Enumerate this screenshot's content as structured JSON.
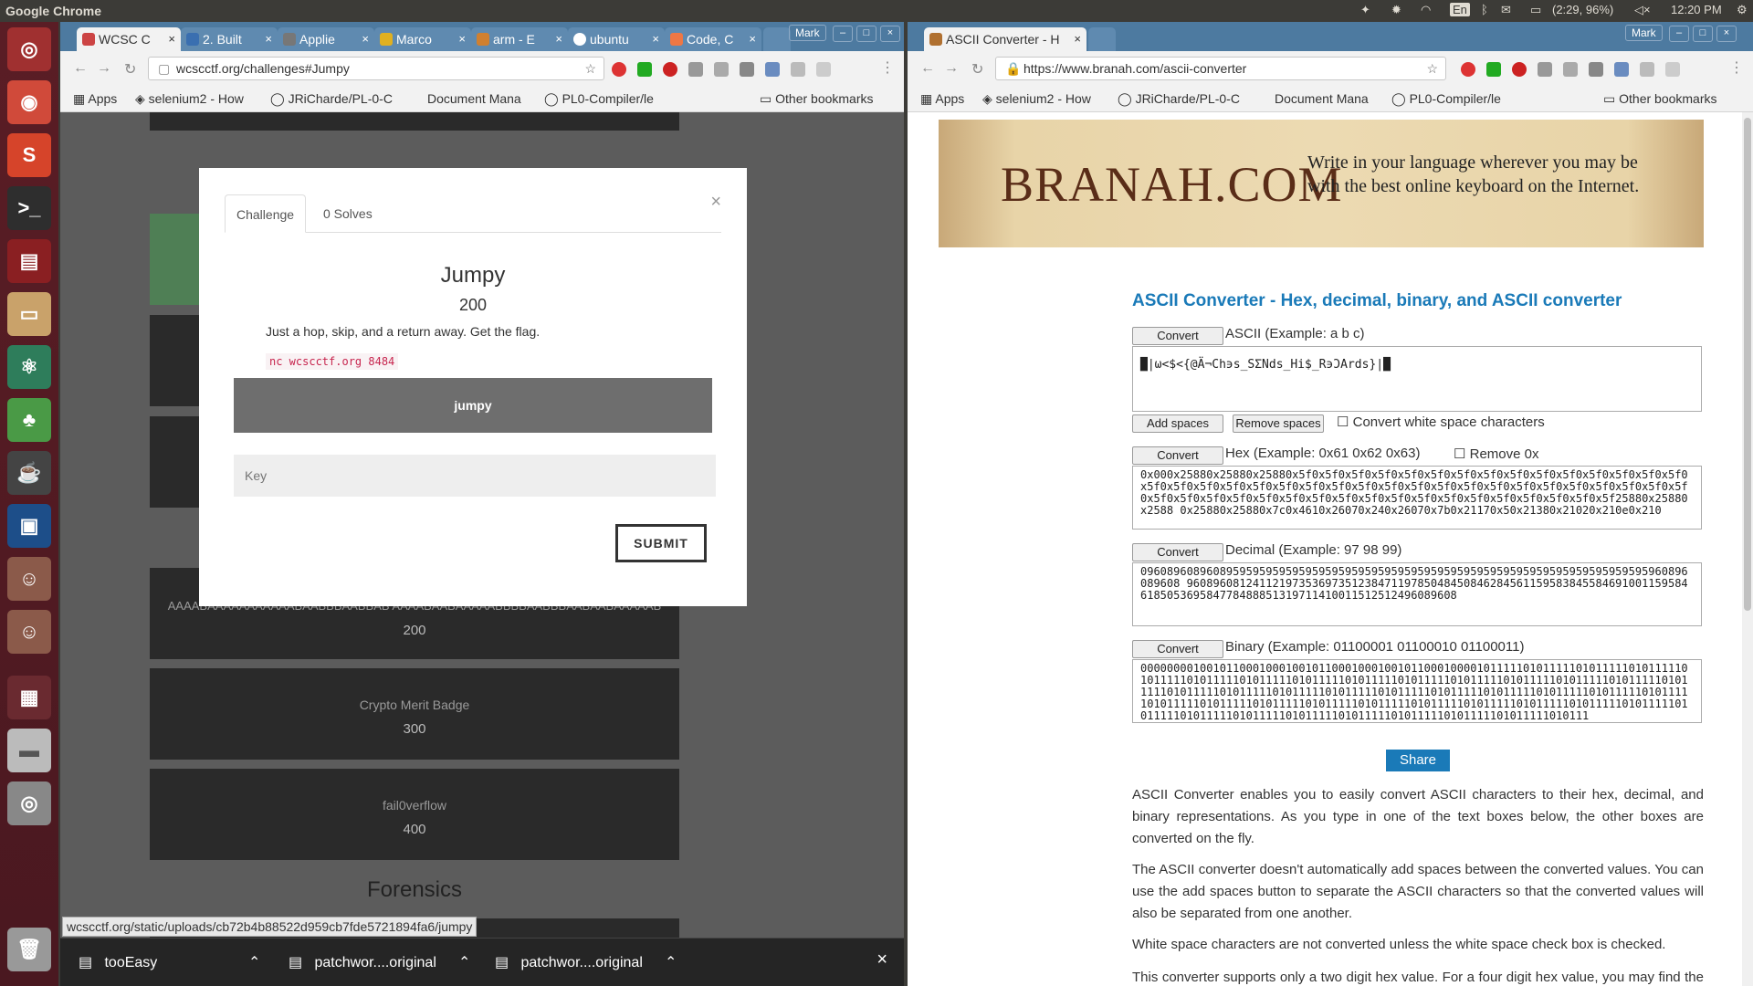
{
  "topbar": {
    "app_name": "Google Chrome",
    "keyboard": "En",
    "battery": "(2:29, 96%)",
    "time": "12:20 PM"
  },
  "left": {
    "user": "Mark",
    "tabs": [
      "WCSC C",
      "2. Built",
      "Applie",
      "Marco",
      "arm - E",
      "ubuntu",
      "Code, C"
    ],
    "url": "wcscctf.org/challenges#Jumpy",
    "bookmarks": [
      "Apps",
      "selenium2 - How",
      "JRiCharde/PL-0-C",
      "Document Mana",
      "PL0-Compiler/le",
      "Other bookmarks"
    ],
    "modal": {
      "tab_challenge": "Challenge",
      "tab_solves": "0 Solves",
      "title": "Jumpy",
      "points": "200",
      "description": "Just a hop, skip, and a return away. Get the flag.",
      "command": "nc wcscctf.org 8484",
      "file_button": "jumpy",
      "key_placeholder": "Key",
      "submit": "SUBMIT",
      "close": "×"
    },
    "cards": [
      {
        "title": "AAAABAAAAAAAAAAABAABBBAABBAB AAAABAABAAAAABBBBAABBBAABAABAAAAAB",
        "points": "200"
      },
      {
        "title": "Crypto Merit Badge",
        "points": "300"
      },
      {
        "title": "fail0verflow",
        "points": "400"
      }
    ],
    "section": "Forensics",
    "status_url": "wcscctf.org/static/uploads/cb72b4b88522d959cb7fde5721894fa6/jumpy",
    "downloads": [
      "tooEasy",
      "patchwor....original",
      "patchwor....original"
    ]
  },
  "right": {
    "user": "Mark",
    "tab": "ASCII Converter - H",
    "url": "https://www.branah.com/ascii-converter",
    "bookmarks": [
      "Apps",
      "selenium2 - How",
      "JRiCharde/PL-0-C",
      "Document Mana",
      "PL0-Compiler/le",
      "Other bookmarks"
    ],
    "banner": {
      "logo": "BRANAH.COM",
      "tagline": "Write in your language wherever you may be with the best online keyboard on the Internet."
    },
    "heading": "ASCII Converter - Hex, decimal, binary, and ASCII converter",
    "convert": "Convert",
    "ascii_label": "ASCII (Example: a b c)",
    "ascii_value": "█|ω<$<{@Ä¬Ch϶s_SΣNds_Hi$_R϶ƆArds}|█",
    "add_spaces": "Add spaces",
    "remove_spaces": "Remove spaces",
    "whitespace_label": "Convert white space characters",
    "hex_label": "Hex (Example: 0x61 0x62 0x63)",
    "remove0x": "Remove 0x",
    "hex_value": "0x000x25880x25880x25880x5f0x5f0x5f0x5f0x5f0x5f0x5f0x5f0x5f0x5f0x5f0x5f0x5f0x5f0x5f0x5f0x5f0x5f0x5f0x5f0x5f0x5f0x5f0x5f0x5f0x5f0x5f0x5f0x5f0x5f0x5f0x5f0x5f0x5f0x5f0x5f0x5f0x5f0x5f0x5f0x5f0x5f0x5f0x5f0x5f0x5f0x5f0x5f0x5f0x5f0x5f0x5f0x5f0x5f25880x25880x2588 0x25880x25880x7c0x4610x26070x240x26070x7b0x21170x50x21380x21020x210e0x210",
    "decimal_label": "Decimal (Example: 97 98 99)",
    "decimal_value": "09608960896089595959595959595959595959595959595959595959595959595959595959595960896089608 960896081241121973536973512384711978504845084628456115958384558469100115958461850536958477848885131971141001151251249608960​8",
    "binary_label": "Binary (Example: 01100001 01100010 01100011)",
    "binary_value": "0000000010010110001000100101100010001001011000100001011111010111110101111101011111010111110101111101011111010111110101111101011111010111110101111101011111010111110101111101011111010111110101111101011111010111110101111101011111010111110101111101011111010111110101111101011111010111110101111101011111010111110101111101011111010111110101111101011111010111110101111101011111010111110101111101011111010111",
    "share": "Share",
    "paragraphs": [
      "ASCII Converter enables you to easily convert ASCII characters to their hex, decimal, and binary representations. As you type in one of the text boxes below, the other boxes are converted on the fly.",
      "The ASCII converter doesn't automatically add spaces between the converted values. You can use the add spaces button to separate the ASCII characters so that the converted values will also be separated from one another.",
      "White space characters are not converted unless the white space check box is checked.",
      "This converter supports only a two digit hex value. For a four digit hex value, you may find the Unicode Converter useful."
    ]
  }
}
